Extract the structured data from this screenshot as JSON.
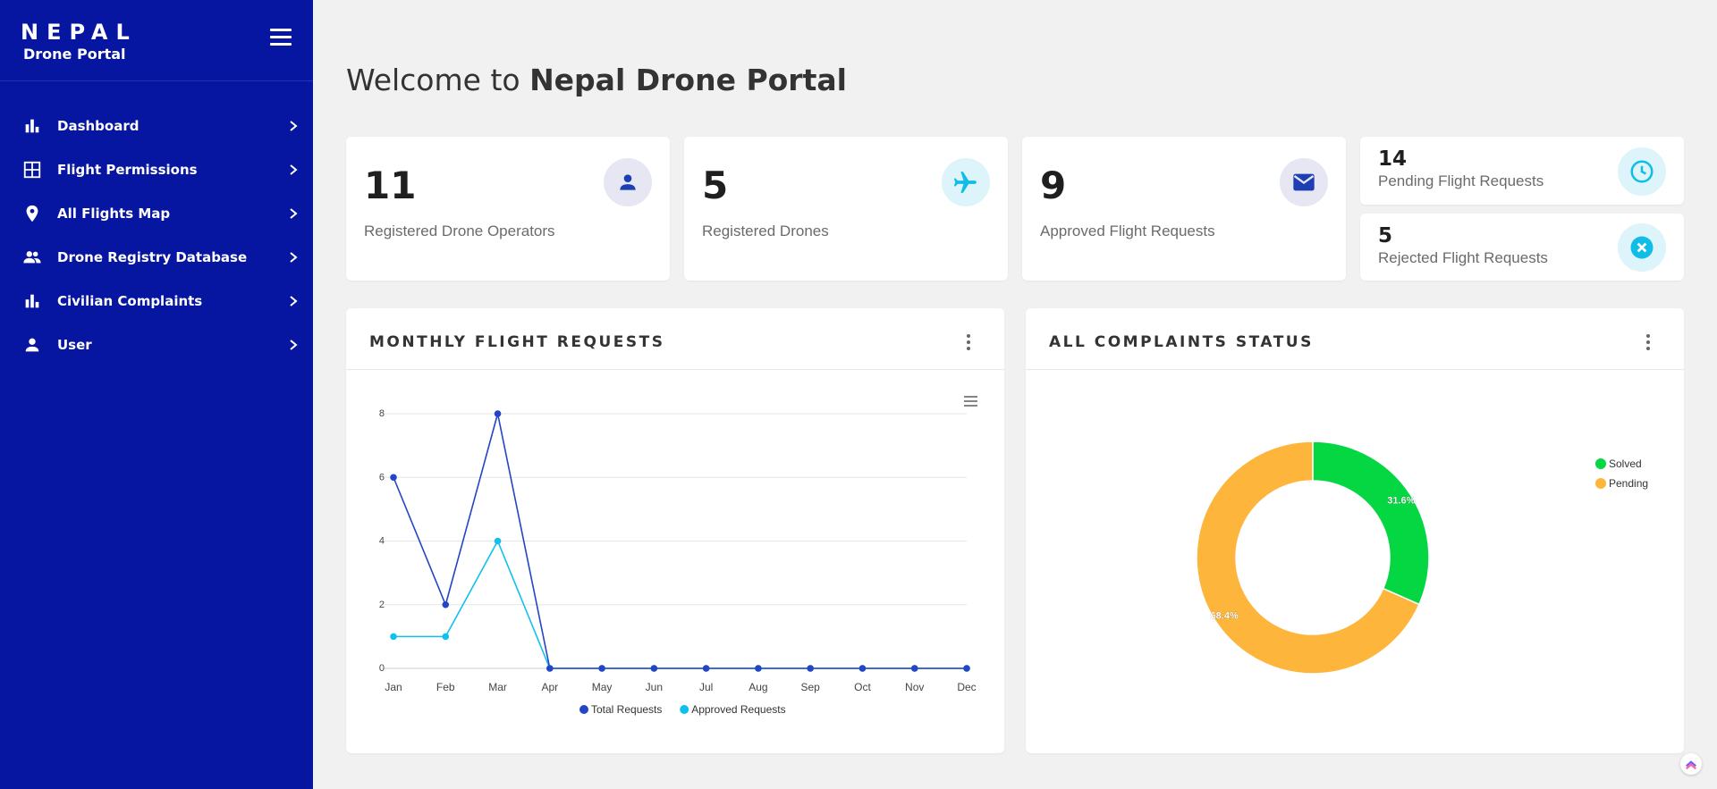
{
  "brand": {
    "title": "NEPAL",
    "subtitle": "Drone Portal"
  },
  "nav": [
    {
      "label": "Dashboard",
      "icon": "bar-chart-icon"
    },
    {
      "label": "Flight Permissions",
      "icon": "grid-icon"
    },
    {
      "label": "All Flights Map",
      "icon": "map-pin-icon"
    },
    {
      "label": "Drone Registry Database",
      "icon": "people-icon"
    },
    {
      "label": "Civilian Complaints",
      "icon": "bar-chart-icon"
    },
    {
      "label": "User",
      "icon": "person-icon"
    }
  ],
  "welcome": {
    "prefix": "Welcome to ",
    "name": "Nepal Drone Portal"
  },
  "stats": [
    {
      "value": "11",
      "label": "Registered Drone Operators",
      "icon": "person-icon",
      "color": "#1e3fb4",
      "bg": "#e6e7f3"
    },
    {
      "value": "5",
      "label": "Registered Drones",
      "icon": "airplane-icon",
      "color": "#10bde6",
      "bg": "#dcf4fa"
    },
    {
      "value": "9",
      "label": "Approved Flight Requests",
      "icon": "mail-icon",
      "color": "#1e3fb4",
      "bg": "#e6e7f3"
    },
    {
      "value": "14",
      "label": "Pending Flight Requests",
      "icon": "clock-icon",
      "color": "#10bde6",
      "bg": "#dcf4fa"
    },
    {
      "value": "5",
      "label": "Rejected Flight Requests",
      "icon": "close-circle-icon",
      "color": "#10bde6",
      "bg": "#dcf4fa"
    }
  ],
  "panels": {
    "monthly": {
      "title": "MONTHLY FLIGHT REQUESTS"
    },
    "complaints": {
      "title": "ALL COMPLAINTS STATUS"
    }
  },
  "chart_data": [
    {
      "type": "line",
      "title": "MONTHLY FLIGHT REQUESTS",
      "categories": [
        "Jan",
        "Feb",
        "Mar",
        "Apr",
        "May",
        "Jun",
        "Jul",
        "Aug",
        "Sep",
        "Oct",
        "Nov",
        "Dec"
      ],
      "series": [
        {
          "name": "Total Requests",
          "values": [
            6,
            2,
            8,
            0,
            0,
            0,
            0,
            0,
            0,
            0,
            0,
            0
          ],
          "color": "#2345c6"
        },
        {
          "name": "Approved Requests",
          "values": [
            1,
            1,
            4,
            0,
            0,
            0,
            0,
            0,
            0,
            0,
            0,
            0
          ],
          "color": "#11c0ef"
        }
      ],
      "yticks": [
        0,
        2,
        4,
        6,
        8
      ],
      "ylim": [
        0,
        8
      ],
      "grid": true,
      "legend": "bottom"
    },
    {
      "type": "pie",
      "title": "ALL COMPLAINTS STATUS",
      "donut": true,
      "slices": [
        {
          "name": "Solved",
          "value": 31.6,
          "label": "31.6%",
          "color": "#04d741"
        },
        {
          "name": "Pending",
          "value": 68.4,
          "label": "68.4%",
          "color": "#fdb53b"
        }
      ],
      "legend": "top-right"
    }
  ]
}
